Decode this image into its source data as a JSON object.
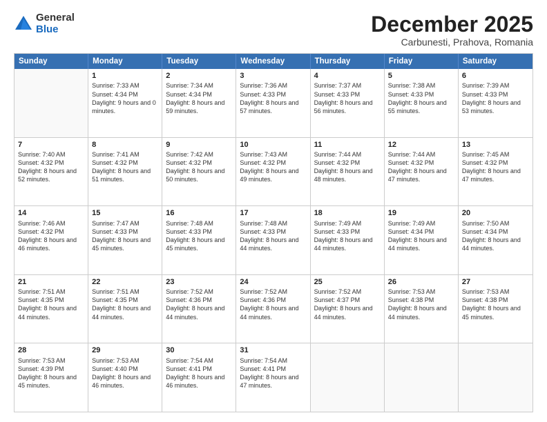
{
  "logo": {
    "general": "General",
    "blue": "Blue"
  },
  "title": "December 2025",
  "subtitle": "Carbunesti, Prahova, Romania",
  "header_days": [
    "Sunday",
    "Monday",
    "Tuesday",
    "Wednesday",
    "Thursday",
    "Friday",
    "Saturday"
  ],
  "weeks": [
    [
      {
        "day": "",
        "info": ""
      },
      {
        "day": "1",
        "info": "Sunrise: 7:33 AM\nSunset: 4:34 PM\nDaylight: 9 hours\nand 0 minutes."
      },
      {
        "day": "2",
        "info": "Sunrise: 7:34 AM\nSunset: 4:34 PM\nDaylight: 8 hours\nand 59 minutes."
      },
      {
        "day": "3",
        "info": "Sunrise: 7:36 AM\nSunset: 4:33 PM\nDaylight: 8 hours\nand 57 minutes."
      },
      {
        "day": "4",
        "info": "Sunrise: 7:37 AM\nSunset: 4:33 PM\nDaylight: 8 hours\nand 56 minutes."
      },
      {
        "day": "5",
        "info": "Sunrise: 7:38 AM\nSunset: 4:33 PM\nDaylight: 8 hours\nand 55 minutes."
      },
      {
        "day": "6",
        "info": "Sunrise: 7:39 AM\nSunset: 4:33 PM\nDaylight: 8 hours\nand 53 minutes."
      }
    ],
    [
      {
        "day": "7",
        "info": "Sunrise: 7:40 AM\nSunset: 4:32 PM\nDaylight: 8 hours\nand 52 minutes."
      },
      {
        "day": "8",
        "info": "Sunrise: 7:41 AM\nSunset: 4:32 PM\nDaylight: 8 hours\nand 51 minutes."
      },
      {
        "day": "9",
        "info": "Sunrise: 7:42 AM\nSunset: 4:32 PM\nDaylight: 8 hours\nand 50 minutes."
      },
      {
        "day": "10",
        "info": "Sunrise: 7:43 AM\nSunset: 4:32 PM\nDaylight: 8 hours\nand 49 minutes."
      },
      {
        "day": "11",
        "info": "Sunrise: 7:44 AM\nSunset: 4:32 PM\nDaylight: 8 hours\nand 48 minutes."
      },
      {
        "day": "12",
        "info": "Sunrise: 7:44 AM\nSunset: 4:32 PM\nDaylight: 8 hours\nand 47 minutes."
      },
      {
        "day": "13",
        "info": "Sunrise: 7:45 AM\nSunset: 4:32 PM\nDaylight: 8 hours\nand 47 minutes."
      }
    ],
    [
      {
        "day": "14",
        "info": "Sunrise: 7:46 AM\nSunset: 4:32 PM\nDaylight: 8 hours\nand 46 minutes."
      },
      {
        "day": "15",
        "info": "Sunrise: 7:47 AM\nSunset: 4:33 PM\nDaylight: 8 hours\nand 45 minutes."
      },
      {
        "day": "16",
        "info": "Sunrise: 7:48 AM\nSunset: 4:33 PM\nDaylight: 8 hours\nand 45 minutes."
      },
      {
        "day": "17",
        "info": "Sunrise: 7:48 AM\nSunset: 4:33 PM\nDaylight: 8 hours\nand 44 minutes."
      },
      {
        "day": "18",
        "info": "Sunrise: 7:49 AM\nSunset: 4:33 PM\nDaylight: 8 hours\nand 44 minutes."
      },
      {
        "day": "19",
        "info": "Sunrise: 7:49 AM\nSunset: 4:34 PM\nDaylight: 8 hours\nand 44 minutes."
      },
      {
        "day": "20",
        "info": "Sunrise: 7:50 AM\nSunset: 4:34 PM\nDaylight: 8 hours\nand 44 minutes."
      }
    ],
    [
      {
        "day": "21",
        "info": "Sunrise: 7:51 AM\nSunset: 4:35 PM\nDaylight: 8 hours\nand 44 minutes."
      },
      {
        "day": "22",
        "info": "Sunrise: 7:51 AM\nSunset: 4:35 PM\nDaylight: 8 hours\nand 44 minutes."
      },
      {
        "day": "23",
        "info": "Sunrise: 7:52 AM\nSunset: 4:36 PM\nDaylight: 8 hours\nand 44 minutes."
      },
      {
        "day": "24",
        "info": "Sunrise: 7:52 AM\nSunset: 4:36 PM\nDaylight: 8 hours\nand 44 minutes."
      },
      {
        "day": "25",
        "info": "Sunrise: 7:52 AM\nSunset: 4:37 PM\nDaylight: 8 hours\nand 44 minutes."
      },
      {
        "day": "26",
        "info": "Sunrise: 7:53 AM\nSunset: 4:38 PM\nDaylight: 8 hours\nand 44 minutes."
      },
      {
        "day": "27",
        "info": "Sunrise: 7:53 AM\nSunset: 4:38 PM\nDaylight: 8 hours\nand 45 minutes."
      }
    ],
    [
      {
        "day": "28",
        "info": "Sunrise: 7:53 AM\nSunset: 4:39 PM\nDaylight: 8 hours\nand 45 minutes."
      },
      {
        "day": "29",
        "info": "Sunrise: 7:53 AM\nSunset: 4:40 PM\nDaylight: 8 hours\nand 46 minutes."
      },
      {
        "day": "30",
        "info": "Sunrise: 7:54 AM\nSunset: 4:41 PM\nDaylight: 8 hours\nand 46 minutes."
      },
      {
        "day": "31",
        "info": "Sunrise: 7:54 AM\nSunset: 4:41 PM\nDaylight: 8 hours\nand 47 minutes."
      },
      {
        "day": "",
        "info": ""
      },
      {
        "day": "",
        "info": ""
      },
      {
        "day": "",
        "info": ""
      }
    ]
  ]
}
